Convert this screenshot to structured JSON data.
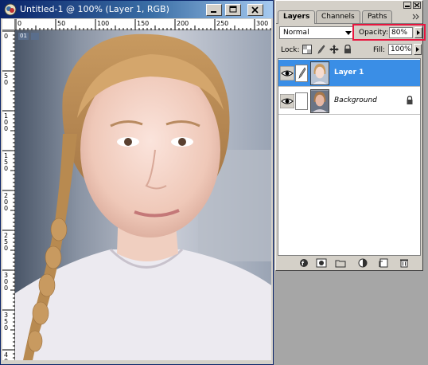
{
  "document": {
    "title": "Untitled-1 @ 100% (Layer 1, RGB)",
    "ruler_h_ticks": [
      "0",
      "50",
      "100",
      "150",
      "200",
      "250",
      "300"
    ],
    "ruler_v_ticks": [
      "0",
      "50",
      "100",
      "150",
      "200",
      "250",
      "300",
      "350",
      "400"
    ],
    "slice_badge": "01"
  },
  "palette": {
    "tabs": [
      "Layers",
      "Channels",
      "Paths"
    ],
    "blend_mode": "Normal",
    "opacity_label": "Opacity:",
    "opacity_value": "80%",
    "lock_label": "Lock:",
    "fill_label": "Fill:",
    "fill_value": "100%",
    "layers": [
      {
        "name": "Layer 1",
        "selected": true,
        "visible": true
      },
      {
        "name": "Background",
        "selected": false,
        "visible": true,
        "locked": true
      }
    ]
  },
  "colors": {
    "selection_blue": "#3a8ee6",
    "highlight_red": "#e8163e",
    "titlebar_dark": "#0a246a"
  }
}
